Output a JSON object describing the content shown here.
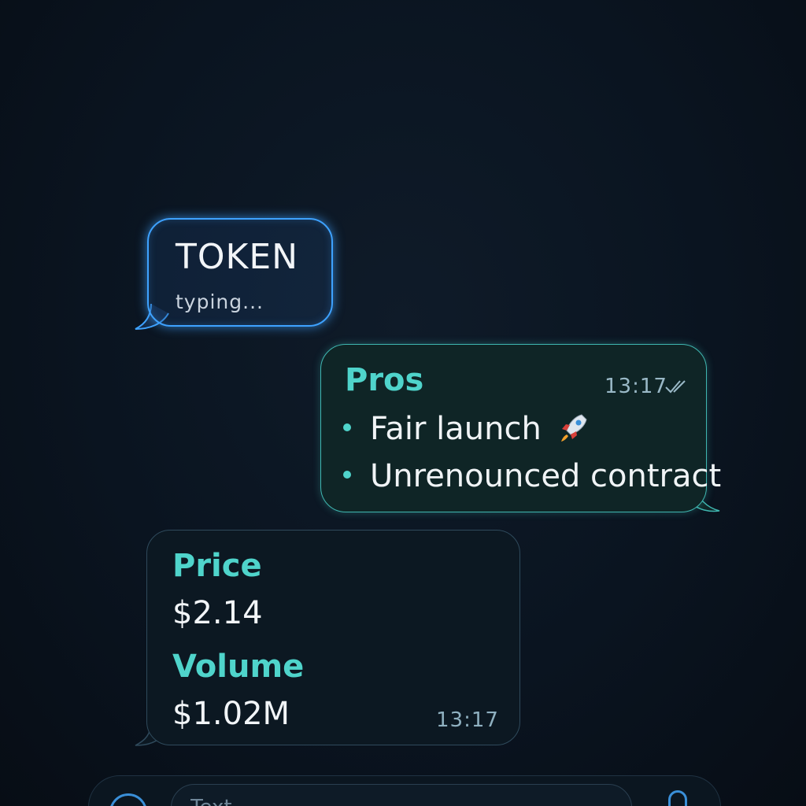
{
  "typing_indicator": {
    "name": "TOKEN",
    "status": "typing..."
  },
  "messages": [
    {
      "direction": "outgoing",
      "title": "Pros",
      "time": "13:17",
      "read_receipt_icon": "double-check-icon",
      "items": [
        {
          "text": "Fair launch",
          "icon": "rocket-icon"
        },
        {
          "text": "Unrenounced contract"
        }
      ]
    },
    {
      "direction": "incoming",
      "price_label": "Price",
      "price_value": "$2.14",
      "volume_label": "Volume",
      "volume_value": "$1.02M",
      "time": "13:17"
    }
  ],
  "input_bar": {
    "placeholder": "Text",
    "left_icon": "emoji-icon",
    "right_icon": "microphone-icon"
  },
  "colors": {
    "background": "#0a1420",
    "typing_glow": "#3ea2ff",
    "accent_teal": "#4fd4cb",
    "outgoing_bubble": "#0f2526",
    "incoming_bubble": "#0c1822"
  }
}
